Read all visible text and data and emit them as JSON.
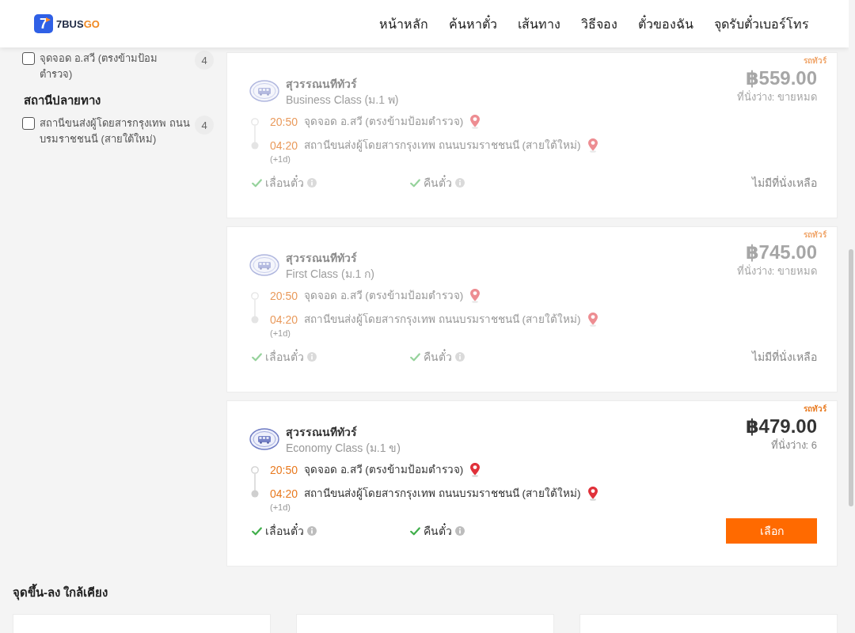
{
  "header": {
    "logo": {
      "mark": "7",
      "name": "7BUS",
      "name_accent": "GO"
    },
    "nav": [
      "หน้าหลัก",
      "ค้นหาตั๋ว",
      "เส้นทาง",
      "วิธีจอง",
      "ตั๋วของฉัน",
      "จุดรับตั๋วเบอร์โทร"
    ]
  },
  "sidebar": {
    "filter_groups": [
      {
        "options": [
          {
            "label": "จุดจอด อ.สวี (ตรงข้ามป้อมตำรวจ)",
            "count": "4",
            "checked": false
          }
        ]
      },
      {
        "title": "สถานีปลายทาง",
        "options": [
          {
            "label": "สถานีขนส่งผู้โดยสารกรุงเทพ ถนนบรมราชชนนี (สายใต้ใหม่)",
            "count": "4",
            "checked": false
          }
        ]
      }
    ]
  },
  "trips": [
    {
      "badge": "รถทัวร์",
      "operator": "สุวรรณนทีทัวร์",
      "bus_class": "Business Class (ม.1 พ)",
      "price": "฿559.00",
      "seats": "ที่นั่งว่าง: ขายหมด",
      "sold_out": true,
      "departure": {
        "time": "20:50",
        "place": "จุดจอด อ.สวี (ตรงข้ามป้อมตำรวจ)"
      },
      "arrival": {
        "time": "04:20",
        "place": "สถานีขนส่งผู้โดยสารกรุงเทพ ถนนบรมราชชนนี (สายใต้ใหม่)",
        "day_offset": "(+1d)"
      },
      "features": [
        {
          "label": "เลื่อนตั๋ว",
          "included": true
        },
        {
          "label": "คืนตั๋ว",
          "included": true
        }
      ],
      "action": {
        "kind": "status",
        "text": "ไม่มีที่นั่งเหลือ"
      }
    },
    {
      "badge": "รถทัวร์",
      "operator": "สุวรรณนทีทัวร์",
      "bus_class": "First Class (ม.1 ก)",
      "price": "฿745.00",
      "seats": "ที่นั่งว่าง: ขายหมด",
      "sold_out": true,
      "departure": {
        "time": "20:50",
        "place": "จุดจอด อ.สวี (ตรงข้ามป้อมตำรวจ)"
      },
      "arrival": {
        "time": "04:20",
        "place": "สถานีขนส่งผู้โดยสารกรุงเทพ ถนนบรมราชชนนี (สายใต้ใหม่)",
        "day_offset": "(+1d)"
      },
      "features": [
        {
          "label": "เลื่อนตั๋ว",
          "included": true
        },
        {
          "label": "คืนตั๋ว",
          "included": true
        }
      ],
      "action": {
        "kind": "status",
        "text": "ไม่มีที่นั่งเหลือ"
      }
    },
    {
      "badge": "รถทัวร์",
      "operator": "สุวรรณนทีทัวร์",
      "bus_class": "Economy Class (ม.1 ข)",
      "price": "฿479.00",
      "seats": "ที่นั่งว่าง: 6",
      "sold_out": false,
      "departure": {
        "time": "20:50",
        "place": "จุดจอด อ.สวี (ตรงข้ามป้อมตำรวจ)"
      },
      "arrival": {
        "time": "04:20",
        "place": "สถานีขนส่งผู้โดยสารกรุงเทพ ถนนบรมราชชนนี (สายใต้ใหม่)",
        "day_offset": "(+1d)"
      },
      "features": [
        {
          "label": "เลื่อนตั๋ว",
          "included": true
        },
        {
          "label": "คืนตั๋ว",
          "included": true
        }
      ],
      "action": {
        "kind": "button",
        "text": "เลือก"
      }
    }
  ],
  "nearby": {
    "title": "จุดขึ้น-ลง ใกล้เคียง"
  }
}
